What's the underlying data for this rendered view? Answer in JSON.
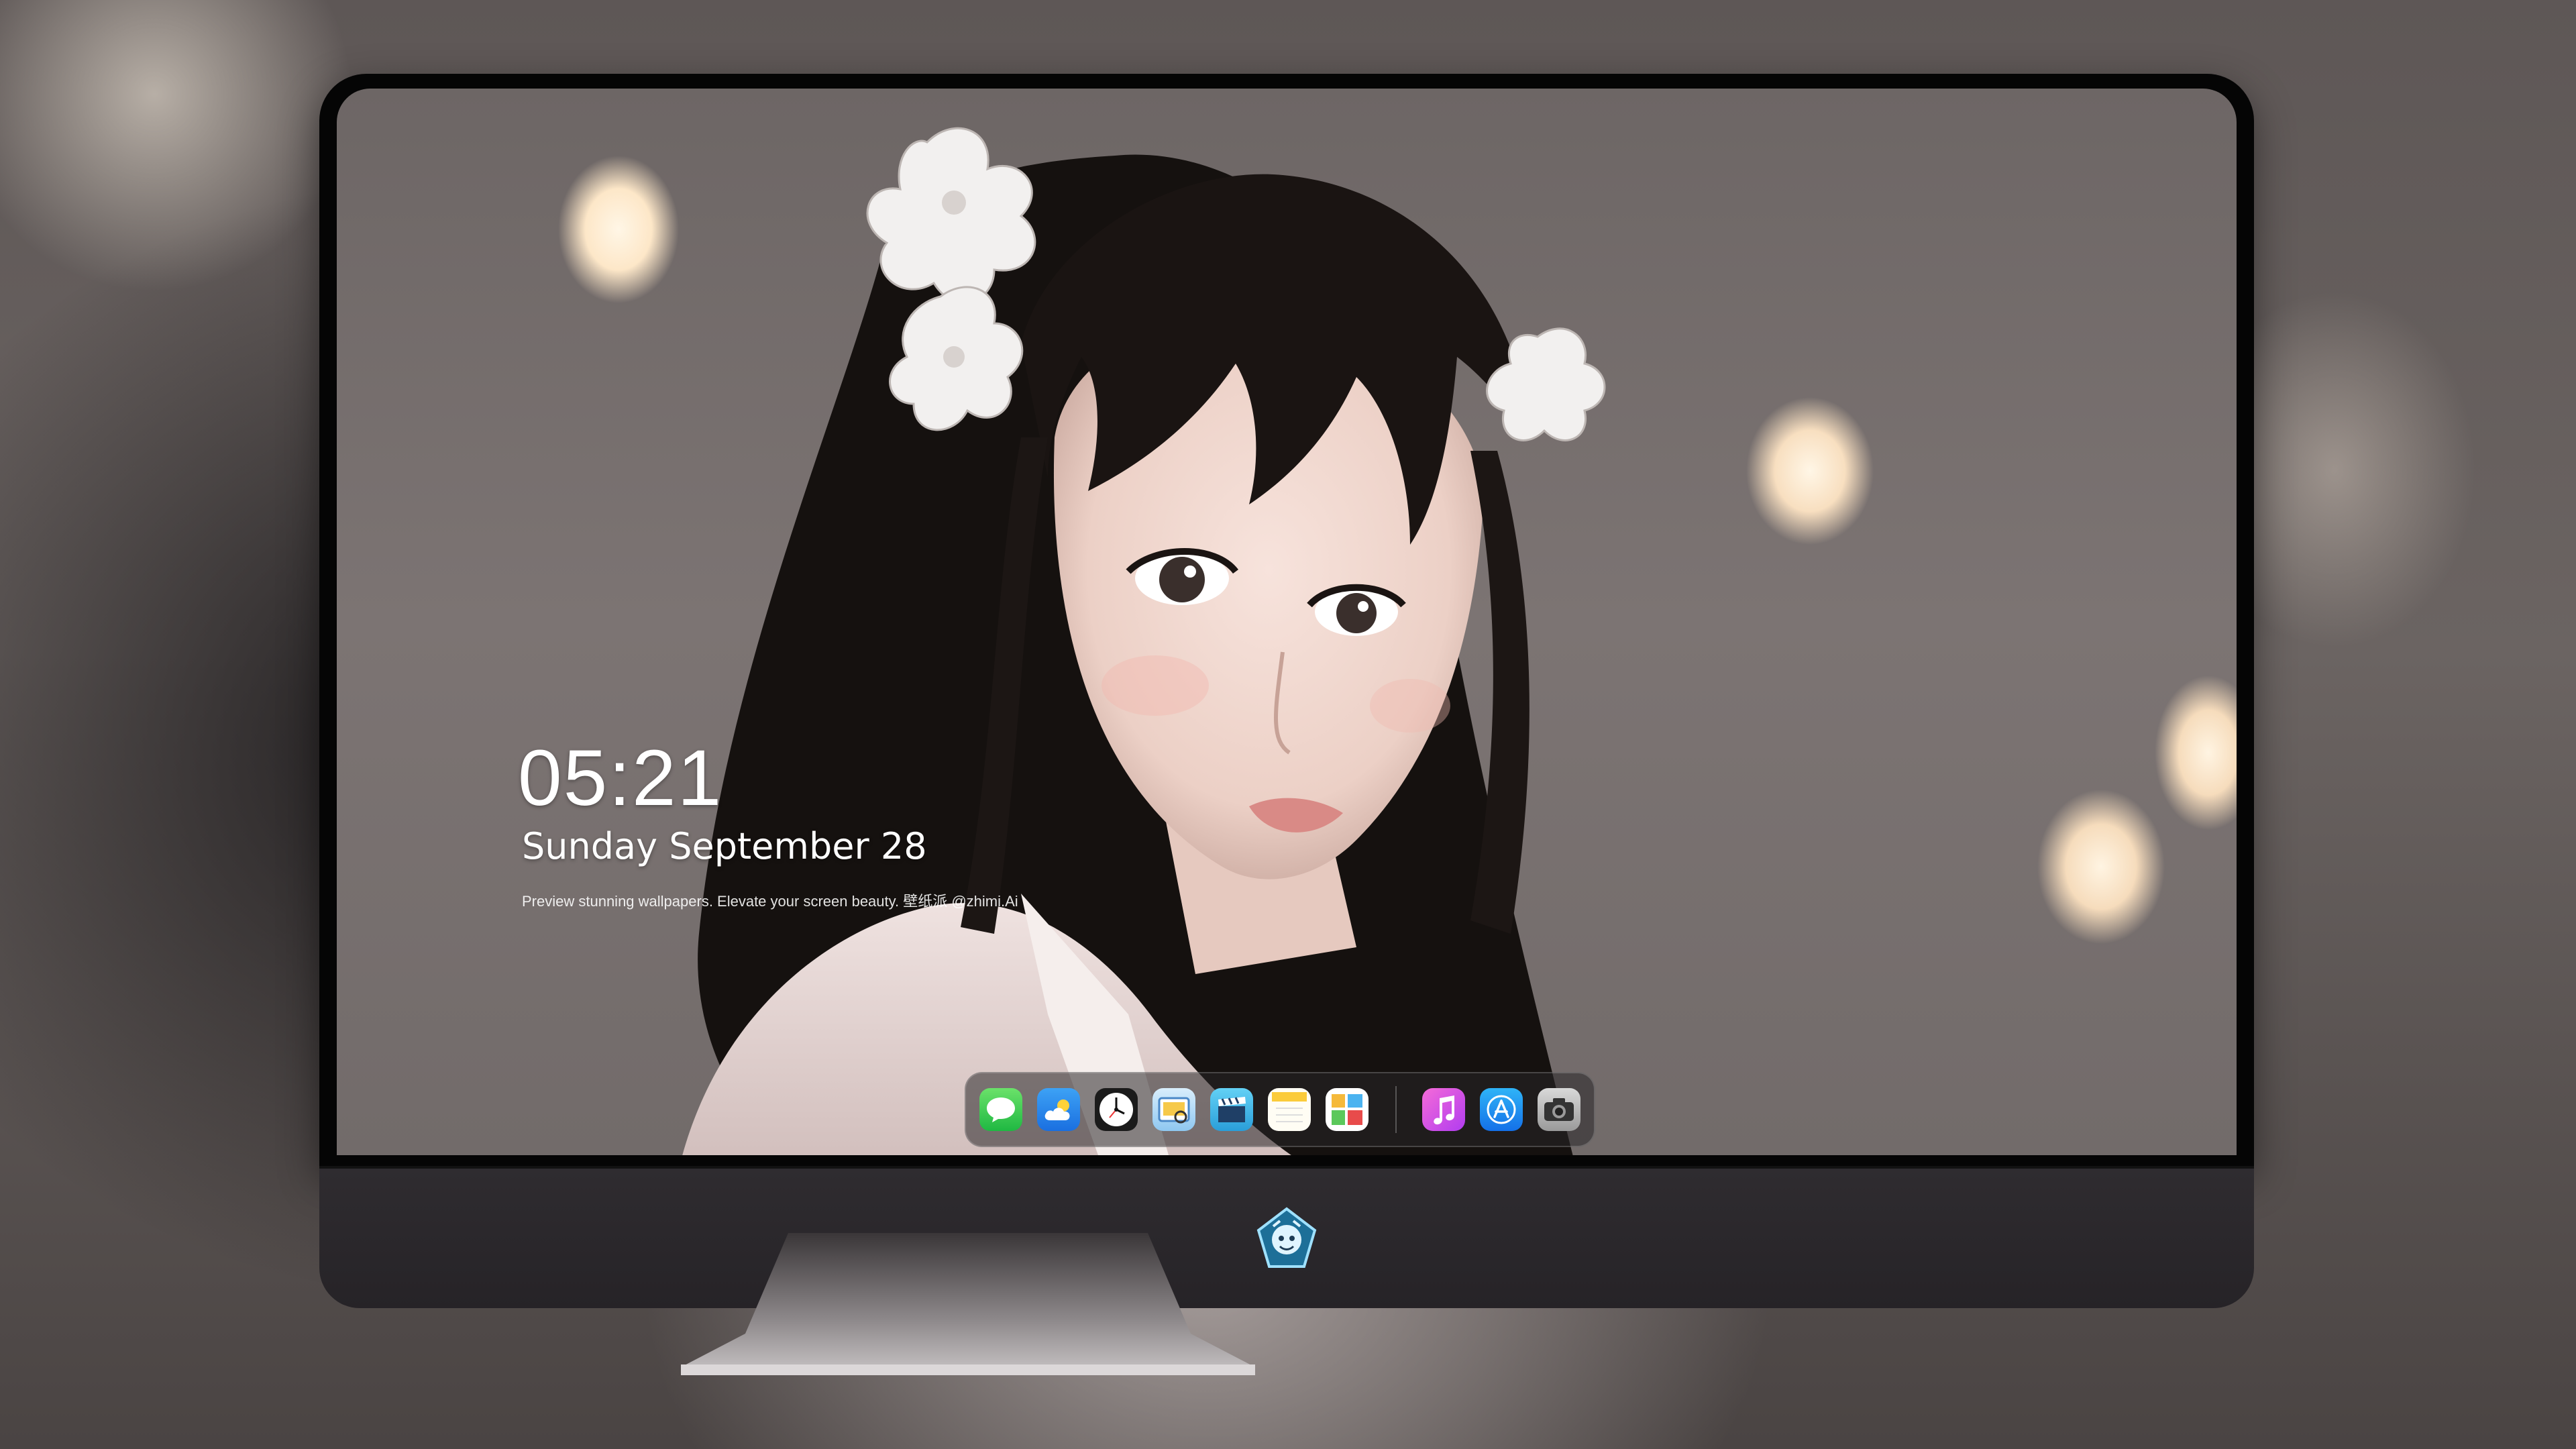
{
  "lock_screen": {
    "time": "05:21",
    "date": "Sunday September  28",
    "tagline": "Preview stunning wallpapers. Elevate your screen beauty. 壁纸派 @zhimi.Ai"
  },
  "dock": {
    "apps": [
      {
        "name": "messages",
        "icon": "message-bubble-icon"
      },
      {
        "name": "weather",
        "icon": "cloud-sun-icon"
      },
      {
        "name": "clock",
        "icon": "clock-icon"
      },
      {
        "name": "preview",
        "icon": "photo-viewer-icon"
      },
      {
        "name": "video",
        "icon": "clapperboard-icon"
      },
      {
        "name": "notes",
        "icon": "notes-icon"
      },
      {
        "name": "photos",
        "icon": "photo-gallery-icon"
      },
      {
        "name": "music",
        "icon": "music-note-icon"
      },
      {
        "name": "app-store",
        "icon": "app-store-icon"
      },
      {
        "name": "camera",
        "icon": "camera-icon"
      }
    ]
  },
  "colors": {
    "bezel": "#050505",
    "chin": "#2f2c30",
    "clock_text": "#ffffff"
  }
}
